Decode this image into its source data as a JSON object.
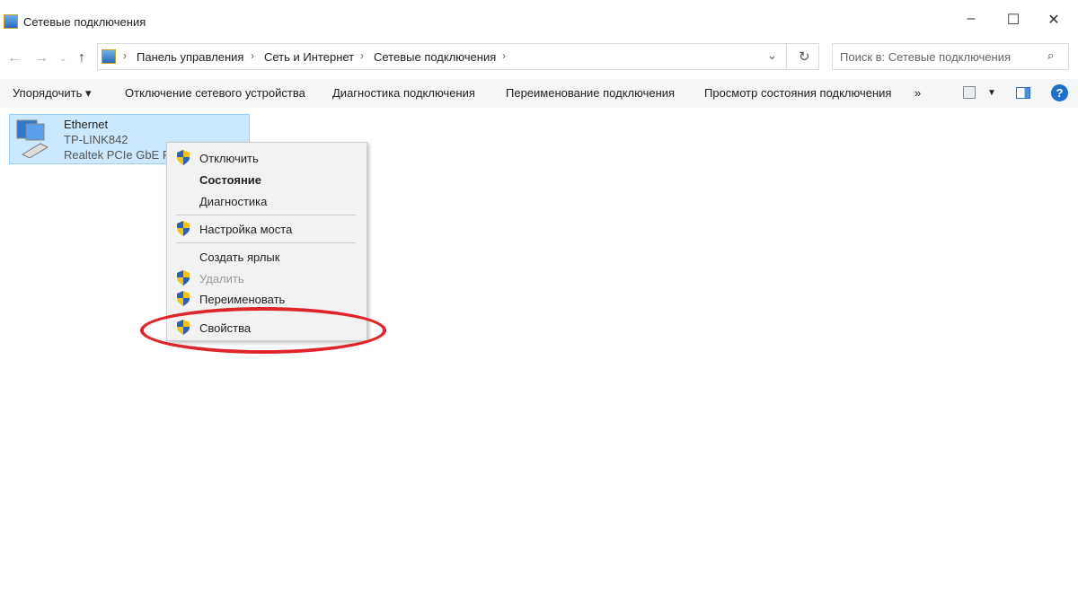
{
  "window": {
    "title": "Сетевые подключения",
    "minimize": "–",
    "maximize": "☐",
    "close": "✕"
  },
  "address": {
    "crumbs": [
      "Панель управления",
      "Сеть и Интернет",
      "Сетевые подключения"
    ],
    "sep": "›"
  },
  "search": {
    "placeholder": "Поиск в: Сетевые подключения"
  },
  "toolbar": {
    "organize": "Упорядочить ▾",
    "disable": "Отключение сетевого устройства",
    "diagnose": "Диагностика подключения",
    "rename": "Переименование подключения",
    "status": "Просмотр состояния подключения",
    "more": "»",
    "help": "?"
  },
  "connection": {
    "name": "Ethernet",
    "network": "TP-LINK842",
    "adapter": "Realtek PCIe GbE Fa"
  },
  "menu": [
    "Отключить",
    "Состояние",
    "Диагностика",
    "Настройка моста",
    "Создать ярлык",
    "Удалить",
    "Переименовать",
    "Свойства"
  ]
}
